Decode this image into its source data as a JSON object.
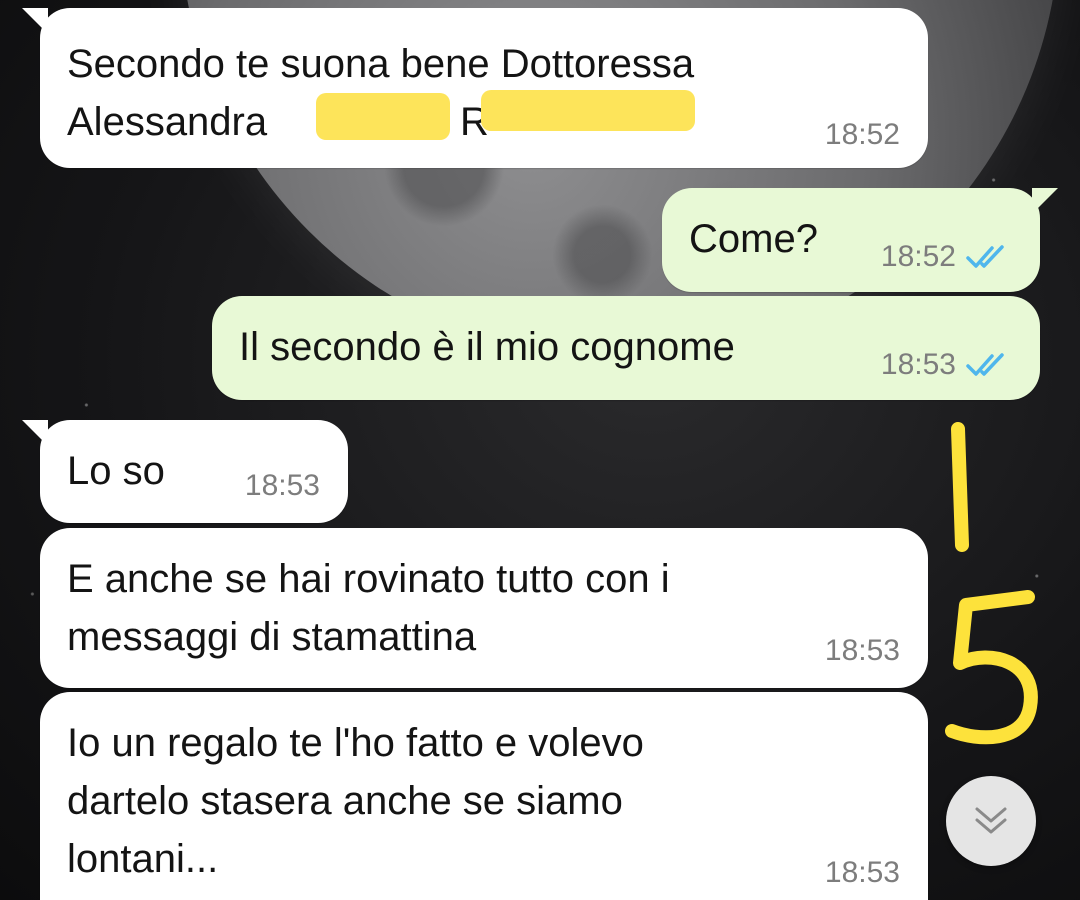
{
  "messages": [
    {
      "id": "m1",
      "direction": "in",
      "text": "Secondo te suona bene Dottoressa\nAlessandra",
      "redacted_initial": "R",
      "time": "18:52"
    },
    {
      "id": "m2",
      "direction": "out",
      "text": "Come?",
      "time": "18:52",
      "status": "read"
    },
    {
      "id": "m3",
      "direction": "out",
      "text": "Il secondo è il mio cognome",
      "time": "18:53",
      "status": "read"
    },
    {
      "id": "m4",
      "direction": "in",
      "text": "Lo so",
      "time": "18:53"
    },
    {
      "id": "m5",
      "direction": "in",
      "text": "E anche se hai rovinato tutto con i\nmessaggi di stamattina",
      "time": "18:53"
    },
    {
      "id": "m6",
      "direction": "in",
      "text": "Io un regalo te l'ho fatto e volevo\ndartelo stasera anche se siamo\nlontani...",
      "time": "18:53"
    }
  ],
  "annotation": {
    "text": "15",
    "color": "#fde23b"
  },
  "colors": {
    "incoming_bubble": "#ffffff",
    "outgoing_bubble": "#e8f9d6",
    "read_ticks": "#4fb6ec",
    "redaction": "#fde45a"
  },
  "icons": {
    "read_status": "double-check-icon",
    "scroll": "chevron-double-down-icon"
  }
}
